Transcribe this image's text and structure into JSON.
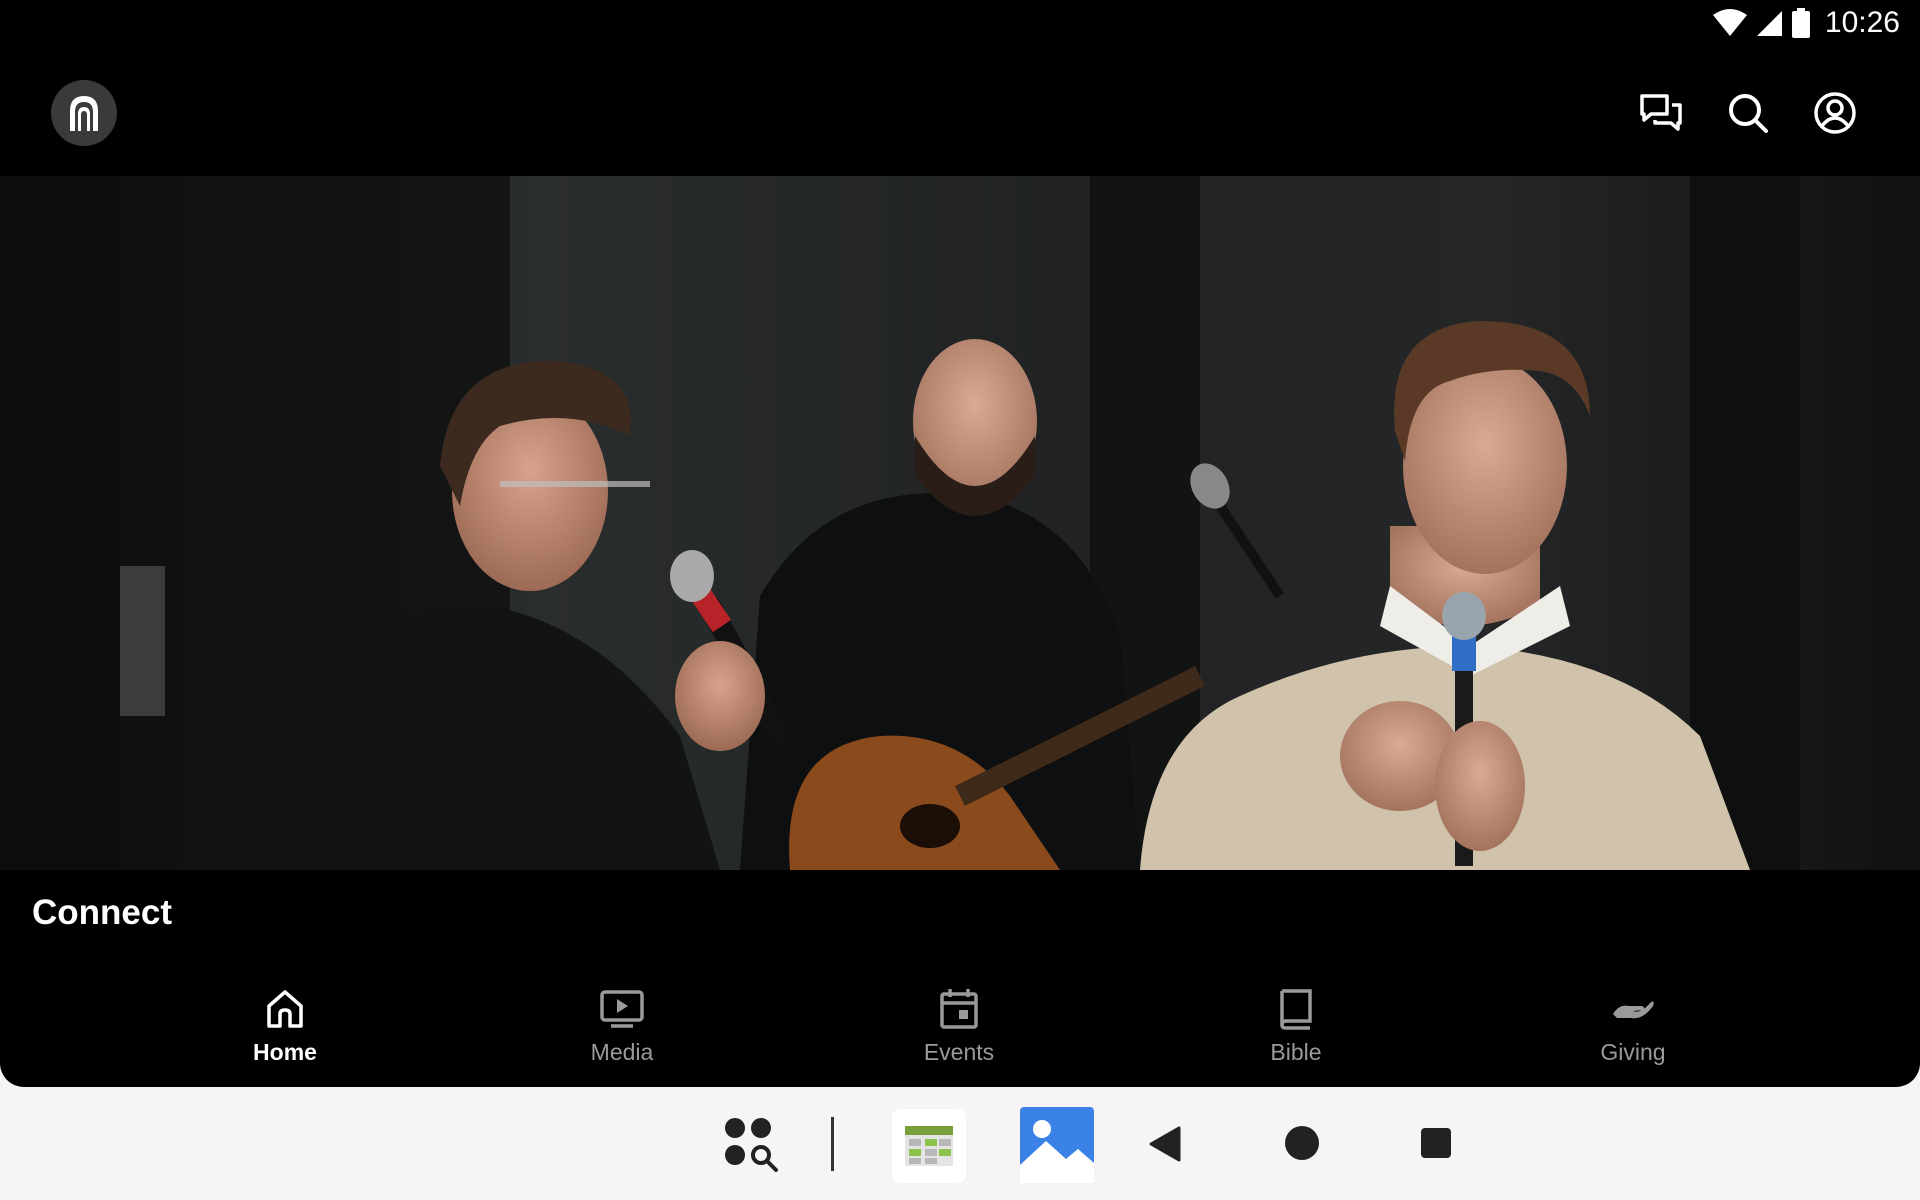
{
  "status_bar": {
    "time": "10:26",
    "icons": [
      "wifi-icon",
      "cellular-signal-icon",
      "battery-icon"
    ]
  },
  "app_bar": {
    "logo": "church-arch-logo",
    "actions": [
      {
        "name": "chat-icon",
        "label": "Messages"
      },
      {
        "name": "search-icon",
        "label": "Search"
      },
      {
        "name": "account-icon",
        "label": "Profile"
      }
    ]
  },
  "hero": {
    "description_icon": "worship-band-photo"
  },
  "section": {
    "title": "Connect"
  },
  "bottom_nav": {
    "items": [
      {
        "label": "Home",
        "icon": "home-icon",
        "active": true
      },
      {
        "label": "Media",
        "icon": "media-play-icon",
        "active": false
      },
      {
        "label": "Events",
        "icon": "calendar-icon",
        "active": false
      },
      {
        "label": "Bible",
        "icon": "book-icon",
        "active": false
      },
      {
        "label": "Giving",
        "icon": "giving-hand-icon",
        "active": false
      }
    ]
  },
  "system_nav": {
    "buttons": [
      "app-search-icon",
      "taskbar-app-spreadsheet",
      "taskbar-app-gallery",
      "back-icon",
      "home-circle-icon",
      "recents-square-icon"
    ]
  },
  "colors": {
    "background": "#000000",
    "active_nav": "#ffffff",
    "inactive_nav": "#9a9a9a",
    "system_bar": "#f7f4f8"
  }
}
